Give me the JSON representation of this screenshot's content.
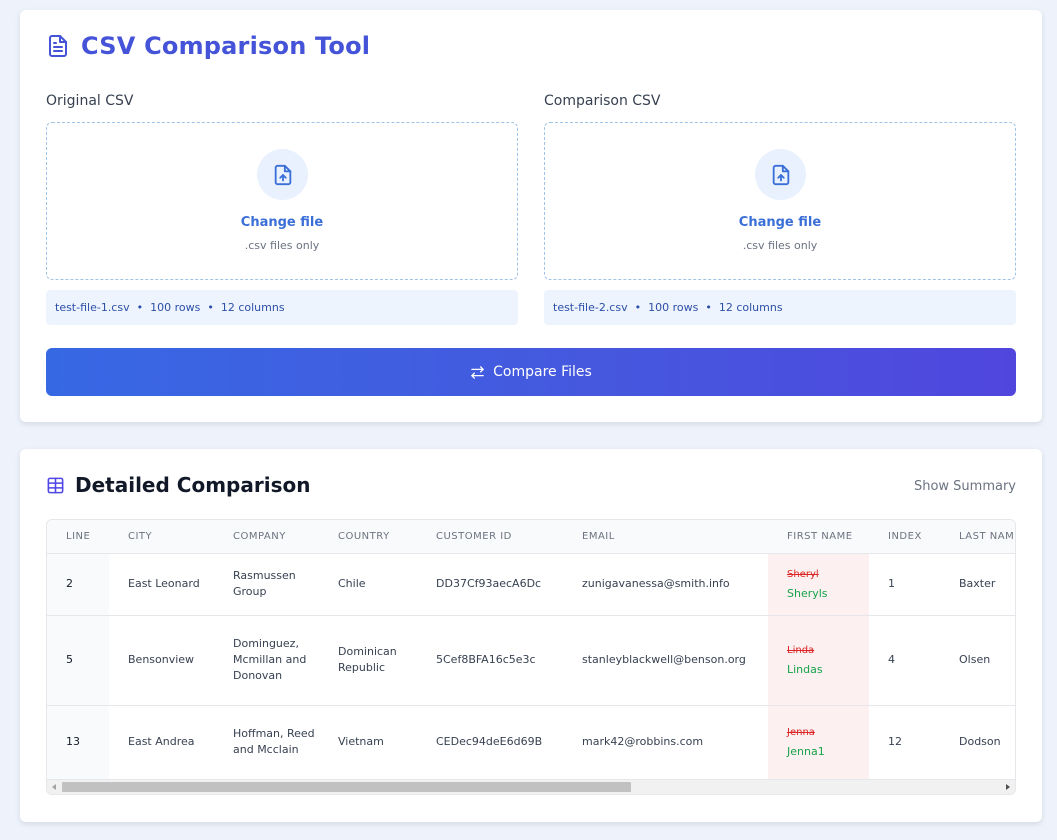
{
  "app": {
    "title": "CSV Comparison Tool",
    "icon": "file-text-icon",
    "accent_color": "#4453d8"
  },
  "upload": {
    "original": {
      "label": "Original CSV",
      "change_label": "Change file",
      "hint": ".csv files only",
      "file_name": "test-file-1.csv",
      "rows": "100 rows",
      "columns": "12 columns"
    },
    "comparison": {
      "label": "Comparison CSV",
      "change_label": "Change file",
      "hint": ".csv files only",
      "file_name": "test-file-2.csv",
      "rows": "100 rows",
      "columns": "12 columns"
    },
    "separator": "•",
    "compare_button_label": "Compare Files"
  },
  "comparison": {
    "title": "Detailed Comparison",
    "summary_toggle_label": "Show Summary",
    "table": {
      "headers": [
        "LINE",
        "CITY",
        "COMPANY",
        "COUNTRY",
        "CUSTOMER ID",
        "EMAIL",
        "FIRST NAME",
        "INDEX",
        "LAST NAME"
      ],
      "rows": [
        {
          "line": "2",
          "city": "East Leonard",
          "company": "Rasmussen Group",
          "country": "Chile",
          "customer_id": "DD37Cf93aecA6Dc",
          "email": "zunigavanessa@smith.info",
          "first_name_old": "Sheryl",
          "first_name_new": "Sheryls",
          "index": "1",
          "last_name": "Baxter"
        },
        {
          "line": "5",
          "city": "Bensonview",
          "company": "Dominguez, Mcmillan and Donovan",
          "country": "Dominican Republic",
          "customer_id": "5Cef8BFA16c5e3c",
          "email": "stanleyblackwell@benson.org",
          "first_name_old": "Linda",
          "first_name_new": "Lindas",
          "index": "4",
          "last_name": "Olsen"
        },
        {
          "line": "13",
          "city": "East Andrea",
          "company": "Hoffman, Reed and Mcclain",
          "country": "Vietnam",
          "customer_id": "CEDec94deE6d69B",
          "email": "mark42@robbins.com",
          "first_name_old": "Jenna",
          "first_name_new": "Jenna1",
          "index": "12",
          "last_name": "Dodson"
        }
      ]
    },
    "colors": {
      "removed": "#dc2626",
      "added": "#16a34a",
      "changed_cell_bg": "#fdf0f0"
    }
  }
}
